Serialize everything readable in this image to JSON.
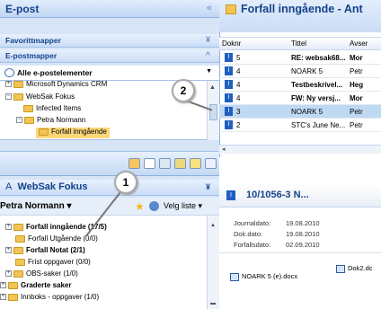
{
  "left": {
    "title": "E-post",
    "collapse_glyph": "«",
    "favoritt_label": "Favorittmapper",
    "favoritt_glyph": "¥",
    "epost_label": "E-postmapper",
    "epost_glyph": "^",
    "mailbox_label": "Alle e-postelementer",
    "tree": [
      {
        "label": "Microsoft Dynamics CRM"
      },
      {
        "label": "WebSak Fokus"
      },
      {
        "label": "Infected Items"
      },
      {
        "label": "Petra Normann"
      },
      {
        "label": "Forfall inngående"
      }
    ],
    "websak_title": "WebSak Fokus",
    "websak_glyph": "¥",
    "user_label": "Petra Normann ▾",
    "velg_label": "Velg liste ▾",
    "tree2": [
      {
        "label": "Forfall inngående (17/5)"
      },
      {
        "label": "Forfall Utgående (0/0)"
      },
      {
        "label": "Forfall Notat (2/1)"
      },
      {
        "label": "Frist oppgaver (0/0)"
      },
      {
        "label": "OBS-saker (1/0)"
      },
      {
        "label": "Graderte saker"
      },
      {
        "label": "Innboks - oppgaver (1/0)"
      }
    ]
  },
  "right": {
    "title": "Forfall inngående - Ant",
    "columns": {
      "doknr": "Doknr",
      "tittel": "Tittel",
      "avsender": "Avser"
    },
    "rows": [
      {
        "n": "5",
        "t": "RE: websak68...",
        "a": "Mor"
      },
      {
        "n": "4",
        "t": "NOARK 5",
        "a": "Petr"
      },
      {
        "n": "4",
        "t": "Testbeskrivel...",
        "a": "Heg"
      },
      {
        "n": "4",
        "t": "FW: Ny versj...",
        "a": "Mor"
      },
      {
        "n": "3",
        "t": "NOARK 5",
        "a": "Petr"
      },
      {
        "n": "2",
        "t": "STC's June Ne...",
        "a": "Petr"
      }
    ],
    "preview_title": "10/1056-3 N...",
    "meta_labels": [
      "Journaldato:",
      "Dok.dato:",
      "Forfallsdato:"
    ],
    "meta_values": [
      "19.08.2010",
      "19.08.2010",
      "02.09.2010"
    ],
    "attachments": [
      "NOARK 5 (e).docx",
      "Dok2.dc"
    ]
  },
  "callouts": [
    "1",
    "2"
  ]
}
